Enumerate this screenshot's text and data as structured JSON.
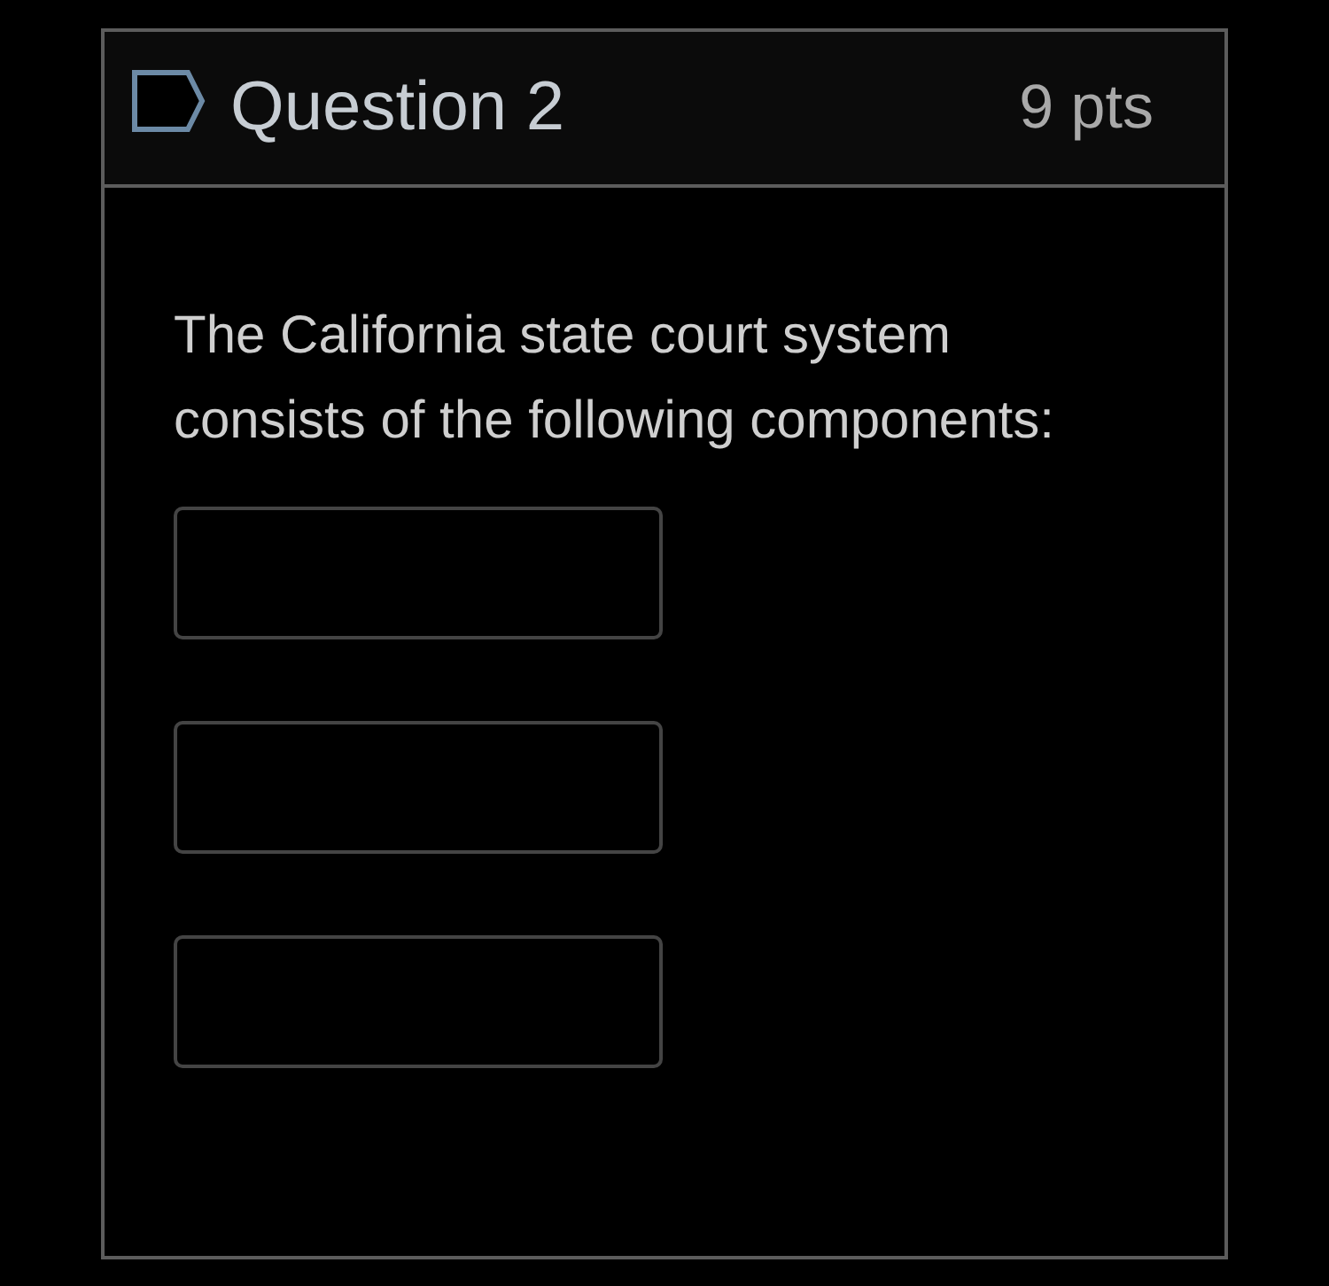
{
  "question": {
    "flagged": false,
    "title": "Question 2",
    "points": "9 pts"
  },
  "prompt": "The California state court system consists of the following components:",
  "answer_fields": [
    {
      "kind": "text"
    },
    {
      "kind": "text"
    },
    {
      "kind": "text"
    }
  ]
}
